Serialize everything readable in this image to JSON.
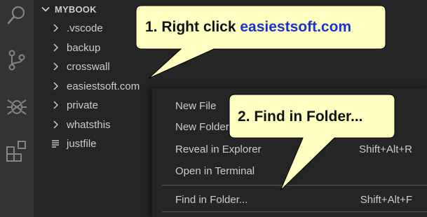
{
  "activity_bar": {
    "icons": [
      "search-icon",
      "source-control-icon",
      "debug-icon",
      "extensions-icon"
    ]
  },
  "explorer": {
    "section_title": "MYBOOK",
    "items": [
      {
        "label": ".vscode",
        "kind": "folder"
      },
      {
        "label": "backup",
        "kind": "folder"
      },
      {
        "label": "crosswall",
        "kind": "folder"
      },
      {
        "label": "easiestsoft.com",
        "kind": "folder"
      },
      {
        "label": "private",
        "kind": "folder"
      },
      {
        "label": "whatsthis",
        "kind": "folder"
      },
      {
        "label": "justfile",
        "kind": "file"
      }
    ]
  },
  "context_menu": {
    "items": [
      {
        "label": "New File",
        "shortcut": ""
      },
      {
        "label": "New Folder...",
        "shortcut": ""
      },
      {
        "label": "Reveal in Explorer",
        "shortcut": "Shift+Alt+R"
      },
      {
        "label": "Open in Terminal",
        "shortcut": ""
      },
      {
        "label": "Find in Folder...",
        "shortcut": "Shift+Alt+F"
      }
    ]
  },
  "callouts": {
    "step1_prefix": "1. Right click ",
    "step1_link": "easiestsoft.com",
    "step2": "2. Find in Folder..."
  },
  "colors": {
    "callout_fill": "#ffffc2",
    "link_blue": "#1a33cc",
    "activity_bar_bg": "#333333",
    "sidebar_bg": "#252526",
    "text": "#cccccc"
  }
}
